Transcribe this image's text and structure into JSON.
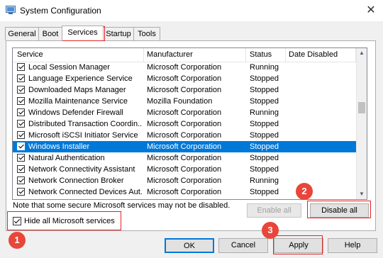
{
  "window": {
    "title": "System Configuration",
    "close_glyph": "✕"
  },
  "tabs": [
    {
      "label": "General",
      "active": false
    },
    {
      "label": "Boot",
      "active": false
    },
    {
      "label": "Services",
      "active": true
    },
    {
      "label": "Startup",
      "active": false
    },
    {
      "label": "Tools",
      "active": false
    }
  ],
  "table": {
    "headers": [
      "Service",
      "Manufacturer",
      "Status",
      "Date Disabled"
    ],
    "rows": [
      {
        "name": "Local Session Manager",
        "manufacturer": "Microsoft Corporation",
        "status": "Running",
        "checked": true
      },
      {
        "name": "Language Experience Service",
        "manufacturer": "Microsoft Corporation",
        "status": "Stopped",
        "checked": true
      },
      {
        "name": "Downloaded Maps Manager",
        "manufacturer": "Microsoft Corporation",
        "status": "Stopped",
        "checked": true
      },
      {
        "name": "Mozilla Maintenance Service",
        "manufacturer": "Mozilla Foundation",
        "status": "Stopped",
        "checked": true
      },
      {
        "name": "Windows Defender Firewall",
        "manufacturer": "Microsoft Corporation",
        "status": "Running",
        "checked": true
      },
      {
        "name": "Distributed Transaction Coordin...",
        "manufacturer": "Microsoft Corporation",
        "status": "Stopped",
        "checked": true
      },
      {
        "name": "Microsoft iSCSI Initiator Service",
        "manufacturer": "Microsoft Corporation",
        "status": "Stopped",
        "checked": true
      },
      {
        "name": "Windows Installer",
        "manufacturer": "Microsoft Corporation",
        "status": "Stopped",
        "checked": true,
        "selected": true
      },
      {
        "name": "Natural Authentication",
        "manufacturer": "Microsoft Corporation",
        "status": "Stopped",
        "checked": true
      },
      {
        "name": "Network Connectivity Assistant",
        "manufacturer": "Microsoft Corporation",
        "status": "Stopped",
        "checked": true
      },
      {
        "name": "Network Connection Broker",
        "manufacturer": "Microsoft Corporation",
        "status": "Running",
        "checked": true
      },
      {
        "name": "Network Connected Devices Aut...",
        "manufacturer": "Microsoft Corporation",
        "status": "Stopped",
        "checked": true
      }
    ]
  },
  "note": "Note that some secure Microsoft services may not be disabled.",
  "hide_ms": {
    "label": "Hide all Microsoft services",
    "checked": true
  },
  "buttons": {
    "enable_all": "Enable all",
    "disable_all": "Disable all",
    "ok": "OK",
    "cancel": "Cancel",
    "apply": "Apply",
    "help": "Help"
  },
  "annotations": {
    "step1": "1",
    "step2": "2",
    "step3": "3",
    "color": "#e32424"
  }
}
